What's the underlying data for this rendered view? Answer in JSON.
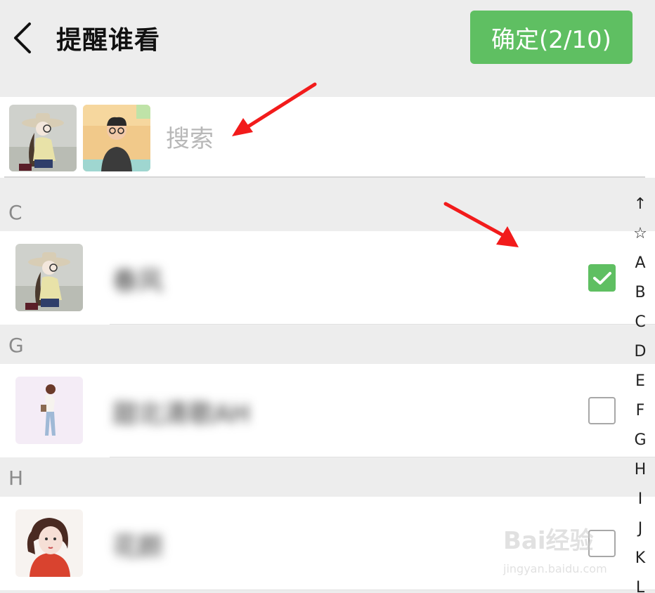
{
  "header": {
    "title": "提醒谁看",
    "confirm_label": "确定(2/10)"
  },
  "search": {
    "placeholder": "搜索"
  },
  "sections": [
    {
      "letter": "C",
      "contacts": [
        {
          "name": "春风",
          "checked": true
        }
      ]
    },
    {
      "letter": "G",
      "contacts": [
        {
          "name": "甜北清歌AH",
          "checked": false
        }
      ]
    },
    {
      "letter": "H",
      "contacts": [
        {
          "name": "花颜",
          "checked": false
        }
      ]
    }
  ],
  "index_bar": [
    "↑",
    "☆",
    "A",
    "B",
    "C",
    "D",
    "E",
    "F",
    "G",
    "H",
    "I",
    "J",
    "K",
    "L"
  ],
  "watermark": {
    "logo_text": "Bai经验",
    "url": "jingyan.baidu.com"
  },
  "colors": {
    "accent_green": "#5fbf62",
    "background": "#ededed",
    "arrow_red": "#f21b1b"
  }
}
